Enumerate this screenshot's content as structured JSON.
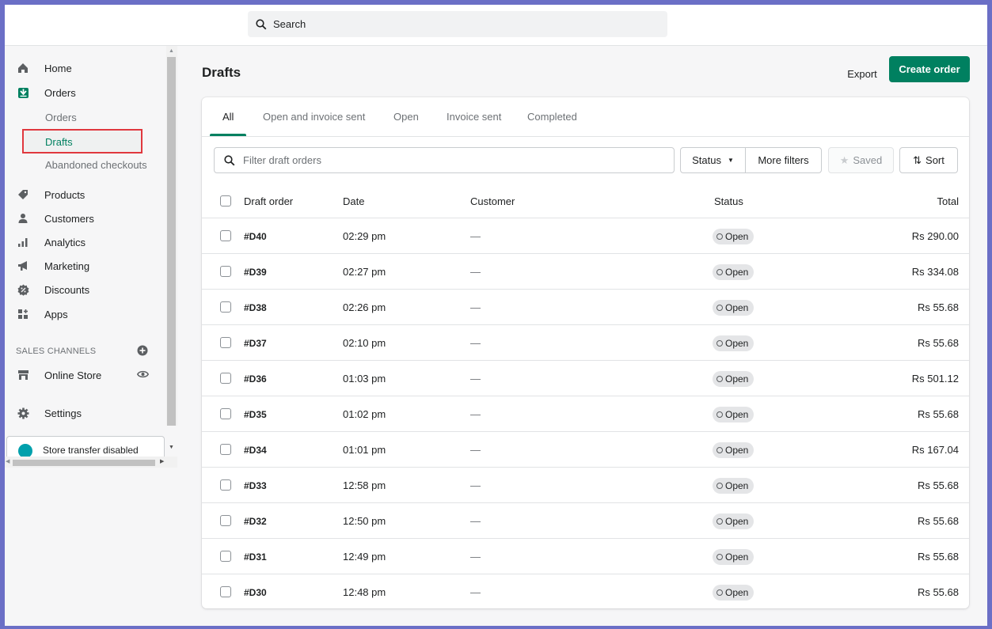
{
  "search": {
    "placeholder": "Search"
  },
  "sidebar": {
    "items": [
      {
        "label": "Home",
        "icon": "home-icon"
      },
      {
        "label": "Orders",
        "icon": "orders-icon"
      },
      {
        "label": "Products",
        "icon": "tag-icon"
      },
      {
        "label": "Customers",
        "icon": "person-icon"
      },
      {
        "label": "Analytics",
        "icon": "bar-chart-icon"
      },
      {
        "label": "Marketing",
        "icon": "megaphone-icon"
      },
      {
        "label": "Discounts",
        "icon": "discount-icon"
      },
      {
        "label": "Apps",
        "icon": "apps-icon"
      }
    ],
    "orders_sub": [
      "Orders",
      "Drafts",
      "Abandoned checkouts"
    ],
    "sales_channels_label": "SALES CHANNELS",
    "online_store": "Online Store",
    "settings": "Settings",
    "store_transfer": "Store transfer disabled"
  },
  "header": {
    "title": "Drafts",
    "export_label": "Export",
    "create_label": "Create order"
  },
  "tabs": [
    "All",
    "Open and invoice sent",
    "Open",
    "Invoice sent",
    "Completed"
  ],
  "filters": {
    "placeholder": "Filter draft orders",
    "status_label": "Status",
    "more_filters_label": "More filters",
    "saved_label": "Saved",
    "sort_label": "Sort"
  },
  "table": {
    "columns": [
      "Draft order",
      "Date",
      "Customer",
      "Status",
      "Total"
    ],
    "rows": [
      {
        "order": "#D40",
        "date": "02:29 pm",
        "customer": "—",
        "status": "Open",
        "total": "Rs 290.00"
      },
      {
        "order": "#D39",
        "date": "02:27 pm",
        "customer": "—",
        "status": "Open",
        "total": "Rs 334.08"
      },
      {
        "order": "#D38",
        "date": "02:26 pm",
        "customer": "—",
        "status": "Open",
        "total": "Rs 55.68"
      },
      {
        "order": "#D37",
        "date": "02:10 pm",
        "customer": "—",
        "status": "Open",
        "total": "Rs 55.68"
      },
      {
        "order": "#D36",
        "date": "01:03 pm",
        "customer": "—",
        "status": "Open",
        "total": "Rs 501.12"
      },
      {
        "order": "#D35",
        "date": "01:02 pm",
        "customer": "—",
        "status": "Open",
        "total": "Rs 55.68"
      },
      {
        "order": "#D34",
        "date": "01:01 pm",
        "customer": "—",
        "status": "Open",
        "total": "Rs 167.04"
      },
      {
        "order": "#D33",
        "date": "12:58 pm",
        "customer": "—",
        "status": "Open",
        "total": "Rs 55.68"
      },
      {
        "order": "#D32",
        "date": "12:50 pm",
        "customer": "—",
        "status": "Open",
        "total": "Rs 55.68"
      },
      {
        "order": "#D31",
        "date": "12:49 pm",
        "customer": "—",
        "status": "Open",
        "total": "Rs 55.68"
      },
      {
        "order": "#D30",
        "date": "12:48 pm",
        "customer": "—",
        "status": "Open",
        "total": "Rs 55.68"
      }
    ]
  },
  "colors": {
    "accent": "#008060",
    "highlight_box": "#e0383e",
    "frame": "#6b6fc6"
  }
}
